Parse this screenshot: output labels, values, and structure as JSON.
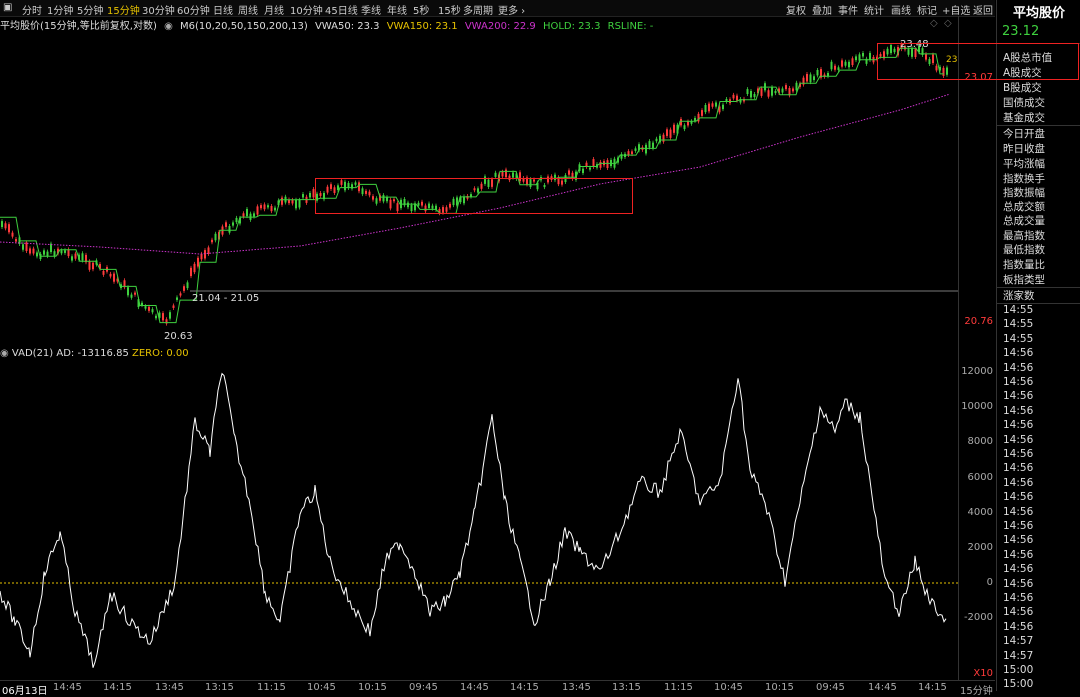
{
  "toolbar": {
    "periods": [
      "分时",
      "1分钟",
      "5分钟",
      "15分钟",
      "30分钟",
      "60分钟",
      "日线",
      "周线",
      "月线",
      "10分钟",
      "45日线",
      "季线",
      "年线",
      "5秒",
      "15秒",
      "多周期",
      "更多 ›"
    ],
    "active_period": "15分钟",
    "right_items": [
      "复权",
      "叠加",
      "事件",
      "统计",
      "画线",
      "标记",
      "+自选",
      "返回"
    ]
  },
  "indicator_line": {
    "title": "平均股价(15分钟,等比前复权,对数)",
    "ma": "M6(10,20,50,150,200,13)",
    "vwa50": "VWA50: 23.3",
    "vwa150": "VWA150: 23.1",
    "vwa200": "VWA200: 22.9",
    "hold": "HOLD: 23.3",
    "rsline": "RSLINE: -"
  },
  "main_chart": {
    "price_labels": {
      "high": "23.48",
      "low": "20.63",
      "range": "21.04 - 21.05",
      "last": "23.07",
      "axis_low": "20.76",
      "top_right": "23"
    }
  },
  "sub_indicator": {
    "title": "VAD(21)",
    "ad": "AD: -13116.85",
    "zero": "ZERO: 0.00",
    "axis_ticks": [
      "12000",
      "10000",
      "8000",
      "6000",
      "4000",
      "2000",
      "0",
      "-2000"
    ],
    "corner": "X10"
  },
  "time_axis": {
    "labels": [
      "06月13日",
      "14:45",
      "14:15",
      "13:45",
      "13:15",
      "11:15",
      "10:45",
      "10:15",
      "09:45",
      "14:45",
      "14:15",
      "13:45",
      "13:15",
      "11:15",
      "10:45",
      "10:15",
      "09:45",
      "14:45",
      "14:15",
      "15分钟"
    ]
  },
  "panel": {
    "title": "平均股价",
    "price": "23.12",
    "items_a": [
      "A股总市值",
      "A股成交",
      "B股成交",
      "国债成交",
      "基金成交"
    ],
    "items_b": [
      "今日开盘",
      "昨日收盘",
      "平均涨幅",
      "指数换手",
      "指数振幅",
      "总成交额",
      "总成交量",
      "最高指数",
      "最低指数",
      "指数量比",
      "板指类型",
      "涨家数"
    ],
    "times": [
      "14:55",
      "14:55",
      "14:55",
      "14:56",
      "14:56",
      "14:56",
      "14:56",
      "14:56",
      "14:56",
      "14:56",
      "14:56",
      "14:56",
      "14:56",
      "14:56",
      "14:56",
      "14:56",
      "14:56",
      "14:56",
      "14:56",
      "14:56",
      "14:56",
      "14:56",
      "14:56",
      "14:57",
      "14:57",
      "15:00",
      "15:00"
    ]
  },
  "colors": {
    "up": "#ff3b3b",
    "down": "#3fd13f",
    "vwa150": "#e6c200",
    "vwa200": "#cc33cc",
    "hold": "#3fd13f",
    "highlight": "#e22"
  }
}
